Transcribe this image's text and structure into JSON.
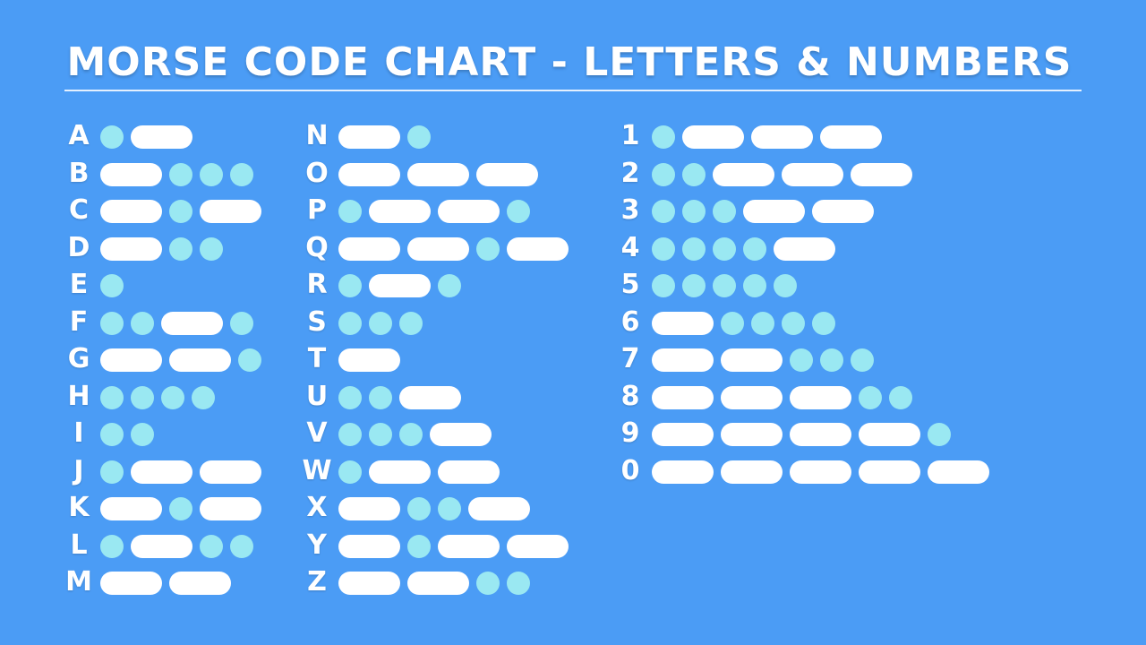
{
  "title": "MORSE CODE CHART - LETTERS & NUMBERS",
  "colors": {
    "background": "#4b9cf5",
    "dot": "#9ae8f2",
    "dash": "#ffffff",
    "text": "#ffffff"
  },
  "columns": [
    {
      "name": "letters-a-m",
      "items": [
        {
          "char": "A",
          "code": ".-"
        },
        {
          "char": "B",
          "code": "-..."
        },
        {
          "char": "C",
          "code": "-.-"
        },
        {
          "char": "D",
          "code": "-.."
        },
        {
          "char": "E",
          "code": "."
        },
        {
          "char": "F",
          "code": "..-."
        },
        {
          "char": "G",
          "code": "--."
        },
        {
          "char": "H",
          "code": "...."
        },
        {
          "char": "I",
          "code": ".."
        },
        {
          "char": "J",
          "code": ".--"
        },
        {
          "char": "K",
          "code": "-.-"
        },
        {
          "char": "L",
          "code": ".-.."
        },
        {
          "char": "M",
          "code": "--"
        }
      ]
    },
    {
      "name": "letters-n-z",
      "items": [
        {
          "char": "N",
          "code": "-."
        },
        {
          "char": "O",
          "code": "---"
        },
        {
          "char": "P",
          "code": ".--."
        },
        {
          "char": "Q",
          "code": "--.-"
        },
        {
          "char": "R",
          "code": ".-."
        },
        {
          "char": "S",
          "code": "..."
        },
        {
          "char": "T",
          "code": "-"
        },
        {
          "char": "U",
          "code": "..-"
        },
        {
          "char": "V",
          "code": "...-"
        },
        {
          "char": "W",
          "code": ".--"
        },
        {
          "char": "X",
          "code": "-..-"
        },
        {
          "char": "Y",
          "code": "-.--"
        },
        {
          "char": "Z",
          "code": "--.."
        }
      ]
    },
    {
      "name": "numbers",
      "items": [
        {
          "char": "1",
          "code": ".---"
        },
        {
          "char": "2",
          "code": "..---"
        },
        {
          "char": "3",
          "code": "...--"
        },
        {
          "char": "4",
          "code": "....-"
        },
        {
          "char": "5",
          "code": "....."
        },
        {
          "char": "6",
          "code": "-...."
        },
        {
          "char": "7",
          "code": "--..."
        },
        {
          "char": "8",
          "code": "---.."
        },
        {
          "char": "9",
          "code": "----."
        },
        {
          "char": "0",
          "code": "-----"
        }
      ]
    }
  ]
}
